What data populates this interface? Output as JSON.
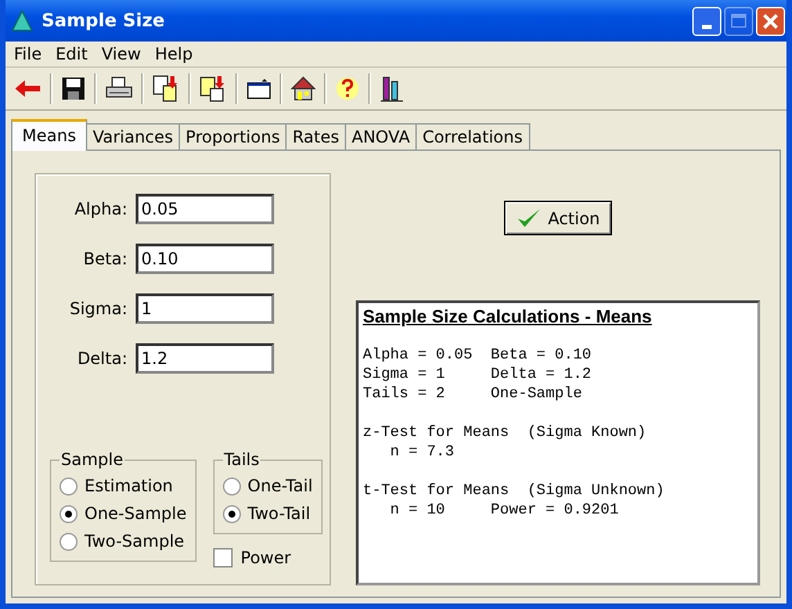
{
  "window": {
    "title": "Sample Size",
    "controls": [
      {
        "kind": "minimize",
        "disabled": false
      },
      {
        "kind": "maximize",
        "disabled": true
      },
      {
        "kind": "close",
        "disabled": false
      }
    ]
  },
  "menu": [
    "File",
    "Edit",
    "View",
    "Help"
  ],
  "tabs": [
    {
      "label": "Means",
      "selected": true
    },
    {
      "label": "Variances",
      "selected": false
    },
    {
      "label": "Proportions",
      "selected": false
    },
    {
      "label": "Rates",
      "selected": false
    },
    {
      "label": "ANOVA",
      "selected": false
    },
    {
      "label": "Correlations",
      "selected": false
    }
  ],
  "fields": [
    {
      "label": "Alpha:",
      "value": "0.05"
    },
    {
      "label": "Beta:",
      "value": "0.10"
    },
    {
      "label": "Sigma:",
      "value": "1"
    },
    {
      "label": "Delta:",
      "value": "1.2"
    }
  ],
  "sample_group": {
    "title": "Sample",
    "options": [
      {
        "label": "Estimation",
        "selected": false
      },
      {
        "label": "One-Sample",
        "selected": true
      },
      {
        "label": "Two-Sample",
        "selected": false
      }
    ]
  },
  "tails_group": {
    "title": "Tails",
    "options": [
      {
        "label": "One-Tail",
        "selected": false
      },
      {
        "label": "Two-Tail",
        "selected": true
      }
    ]
  },
  "power_checkbox": {
    "label": "Power",
    "checked": false
  },
  "action_button": "Action",
  "output": {
    "heading": "Sample Size Calculations - Means",
    "blocks": [
      [
        "Alpha = 0.05  Beta = 0.10",
        "Sigma = 1     Delta = 1.2",
        "Tails = 2     One-Sample"
      ],
      [
        "z-Test for Means  (Sigma Known)",
        "   n = 7.3"
      ],
      [
        "t-Test for Means  (Sigma Unknown)",
        "   n = 10     Power = 0.9201"
      ]
    ]
  }
}
